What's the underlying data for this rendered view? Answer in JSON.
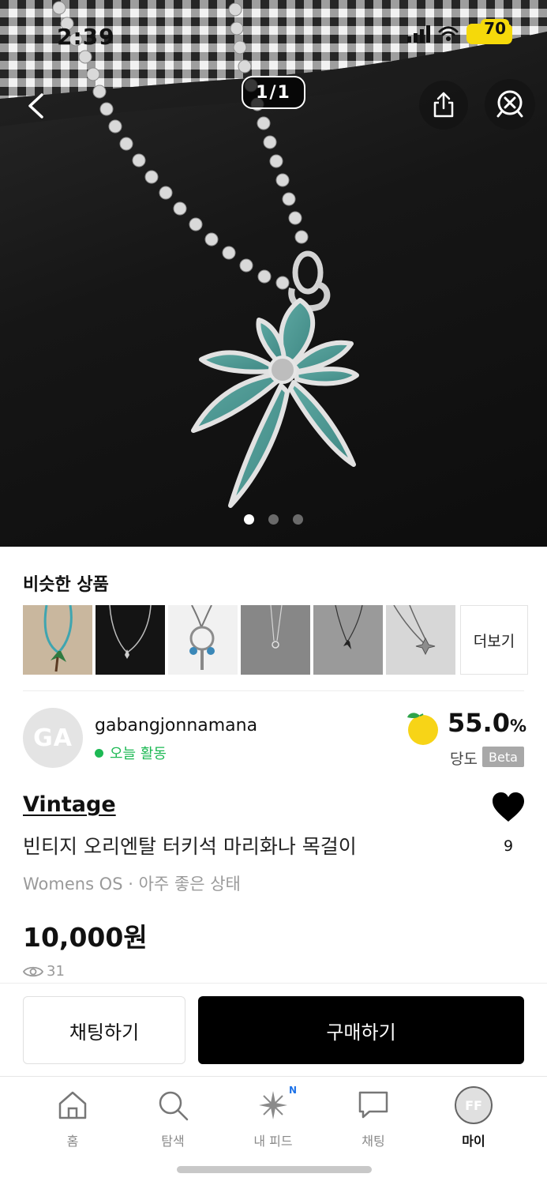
{
  "status_bar": {
    "time": "2:39",
    "battery": "70"
  },
  "hero": {
    "page_counter": "1/1",
    "image_count": 3,
    "active_index": 0
  },
  "similar": {
    "title": "비슷한 상품",
    "more_label": "더보기",
    "item_count": 6
  },
  "seller": {
    "avatar_initials": "GA",
    "name": "gabangjonnamana",
    "activity": "오늘 활동",
    "sweetness_value": "55.0",
    "sweetness_unit": "%",
    "sweetness_label": "당도",
    "beta_label": "Beta"
  },
  "product": {
    "brand": "Vintage",
    "title": "빈티지 오리엔탈 터키석 마리화나 목걸이",
    "meta": "Womens OS · 아주 좋은 상태",
    "price": "10,000원",
    "views": "31",
    "likes": "9"
  },
  "actions": {
    "chat_label": "채팅하기",
    "buy_label": "구매하기"
  },
  "nav": {
    "items": [
      {
        "label": "홈",
        "icon": "home-icon"
      },
      {
        "label": "탐색",
        "icon": "search-icon"
      },
      {
        "label": "내 피드",
        "icon": "sparkle-icon",
        "badge": "N"
      },
      {
        "label": "채팅",
        "icon": "chat-bubble-icon"
      },
      {
        "label": "마이",
        "icon": "profile-avatar",
        "avatar_initials": "FF",
        "active": true
      }
    ]
  },
  "colors": {
    "active_green": "#1db954",
    "buy_button": "#000000",
    "beta_badge": "#a8a8a8",
    "badge_blue": "#1e73e8"
  }
}
